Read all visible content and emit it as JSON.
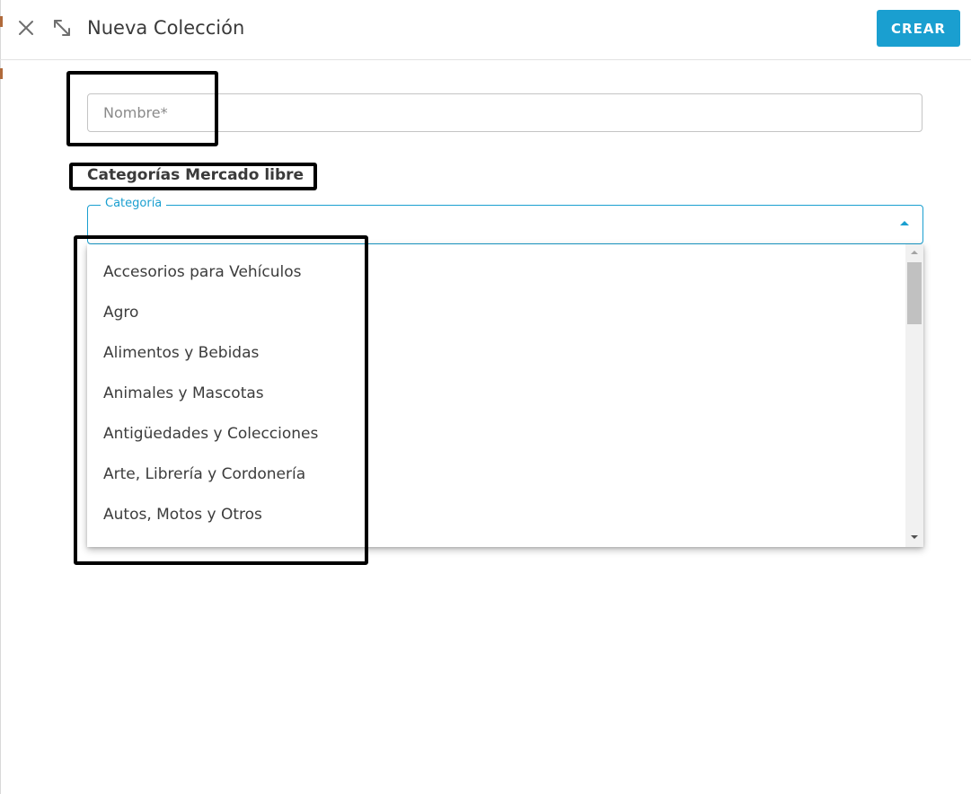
{
  "header": {
    "title": "Nueva Colección",
    "create_label": "CREAR",
    "close_icon": "close-icon",
    "expand_icon": "expand-diagonal-icon"
  },
  "form": {
    "name_placeholder": "Nombre*",
    "name_value": "",
    "section_label": "Categorías Mercado libre",
    "category_label": "Categoría",
    "category_value": ""
  },
  "dropdown": {
    "options": [
      "Accesorios para Vehículos",
      "Agro",
      "Alimentos y Bebidas",
      "Animales y Mascotas",
      "Antigüedades y Colecciones",
      "Arte, Librería y Cordonería",
      "Autos, Motos y Otros"
    ]
  },
  "colors": {
    "accent": "#1a9fd0",
    "annotation": "#000000",
    "text": "#3c3c3c",
    "placeholder": "#8a8a8a"
  }
}
